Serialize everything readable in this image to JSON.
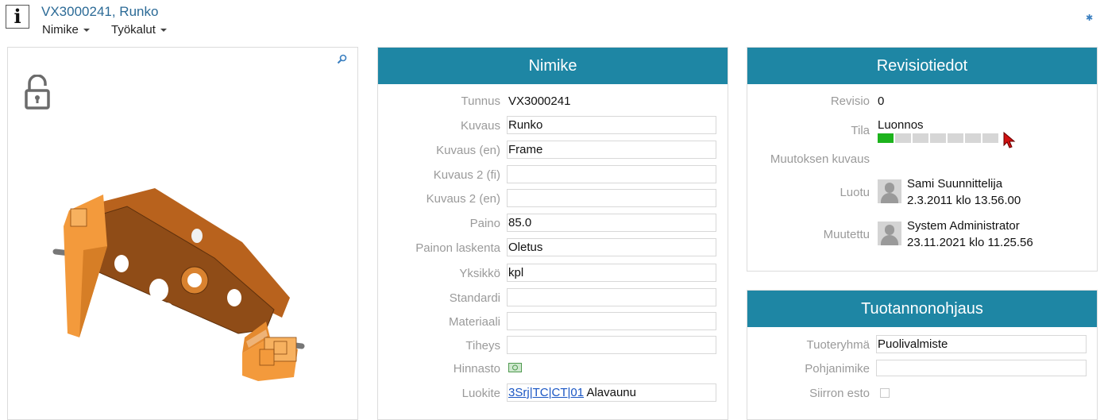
{
  "header": {
    "title": "VX3000241, Runko",
    "menus": [
      "Nimike",
      "Työkalut"
    ]
  },
  "nimike": {
    "heading": "Nimike",
    "fields": [
      {
        "label": "Tunnus",
        "value": "VX3000241"
      },
      {
        "label": "Kuvaus",
        "value": "Runko"
      },
      {
        "label": "Kuvaus (en)",
        "value": "Frame"
      },
      {
        "label": "Kuvaus 2 (fi)",
        "value": ""
      },
      {
        "label": "Kuvaus 2 (en)",
        "value": ""
      },
      {
        "label": "Paino",
        "value": "85.0"
      },
      {
        "label": "Painon laskenta",
        "value": "Oletus"
      },
      {
        "label": "Yksikkö",
        "value": "kpl"
      },
      {
        "label": "Standardi",
        "value": ""
      },
      {
        "label": "Materiaali",
        "value": ""
      },
      {
        "label": "Tiheys",
        "value": ""
      },
      {
        "label": "Hinnasto",
        "value": ""
      },
      {
        "label": "Luokite",
        "value": ""
      }
    ],
    "luokite_links": [
      "3Srj",
      "TC",
      "CT",
      "01"
    ],
    "luokite_separator": "|",
    "luokite_text": "Alavaunu"
  },
  "revisio": {
    "heading": "Revisiotiedot",
    "revisio_label": "Revisio",
    "revisio_value": "0",
    "tila_label": "Tila",
    "tila_value": "Luonnos",
    "tila_progress": {
      "filled": 1,
      "total": 7,
      "filled_color": "#1db31d",
      "empty_color": "#d6d6d6"
    },
    "muutoksen_kuvaus_label": "Muutoksen kuvaus",
    "luotu_label": "Luotu",
    "luotu_name": "Sami Suunnittelija",
    "luotu_date": "2.3.2011 klo 13.56.00",
    "muutettu_label": "Muutettu",
    "muutettu_name": "System Administrator",
    "muutettu_date": "23.11.2021 klo 11.25.56"
  },
  "tuotanto": {
    "heading": "Tuotannonohjaus",
    "tuoteryhma_label": "Tuoteryhmä",
    "tuoteryhma_value": "Puolivalmiste",
    "pohjanimike_label": "Pohjanimike",
    "pohjanimike_value": "",
    "siirron_esto_label": "Siirron esto",
    "siirron_esto_checked": false
  },
  "colors": {
    "accent": "#1e86a4",
    "link": "#2b6a96",
    "model_orange": "#f39a3c"
  },
  "icons": [
    "info-icon",
    "gear-icon",
    "zoom-icon",
    "unlock-icon",
    "money-icon",
    "user-avatar-icon"
  ]
}
